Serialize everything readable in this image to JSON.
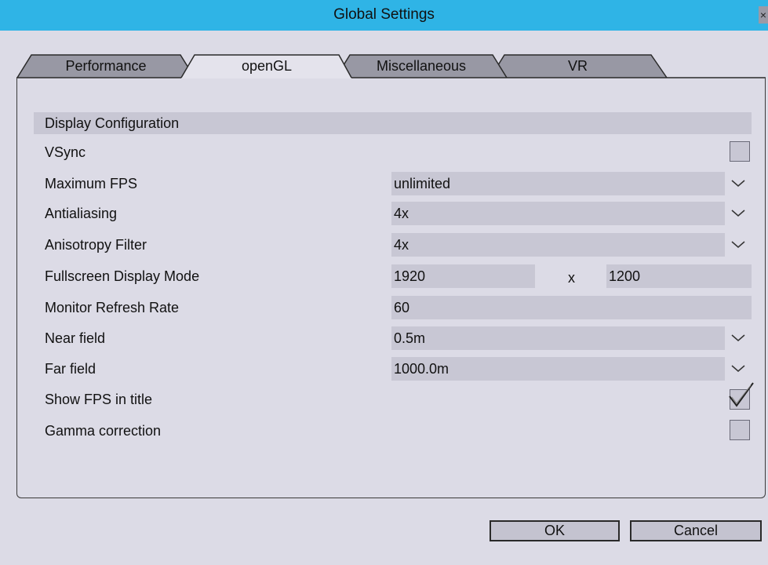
{
  "window": {
    "title": "Global Settings",
    "close_glyph": "×"
  },
  "tabs": [
    {
      "label": "Performance",
      "active": false
    },
    {
      "label": "openGL",
      "active": true
    },
    {
      "label": "Miscellaneous",
      "active": false
    },
    {
      "label": "VR",
      "active": false
    }
  ],
  "section": {
    "title": "Display Configuration"
  },
  "settings": {
    "vsync": {
      "label": "VSync",
      "checked": false
    },
    "max_fps": {
      "label": "Maximum FPS",
      "value": "unlimited"
    },
    "antialiasing": {
      "label": "Antialiasing",
      "value": "4x"
    },
    "anisotropy": {
      "label": "Anisotropy Filter",
      "value": "4x"
    },
    "fullscreen": {
      "label": "Fullscreen Display Mode",
      "width": "1920",
      "separator": "x",
      "height": "1200"
    },
    "refresh": {
      "label": "Monitor Refresh Rate",
      "value": "60"
    },
    "near_field": {
      "label": "Near field",
      "value": "0.5m"
    },
    "far_field": {
      "label": "Far field",
      "value": "1000.0m"
    },
    "show_fps": {
      "label": "Show FPS in title",
      "checked": true
    },
    "gamma": {
      "label": "Gamma correction",
      "checked": false
    }
  },
  "buttons": {
    "ok": "OK",
    "cancel": "Cancel"
  },
  "colors": {
    "title_bar": "#2fb4e6",
    "background": "#dcdbe6",
    "field": "#c8c7d4",
    "active_tab": "#e4e3ec",
    "inactive_tab": "#9898a4"
  }
}
